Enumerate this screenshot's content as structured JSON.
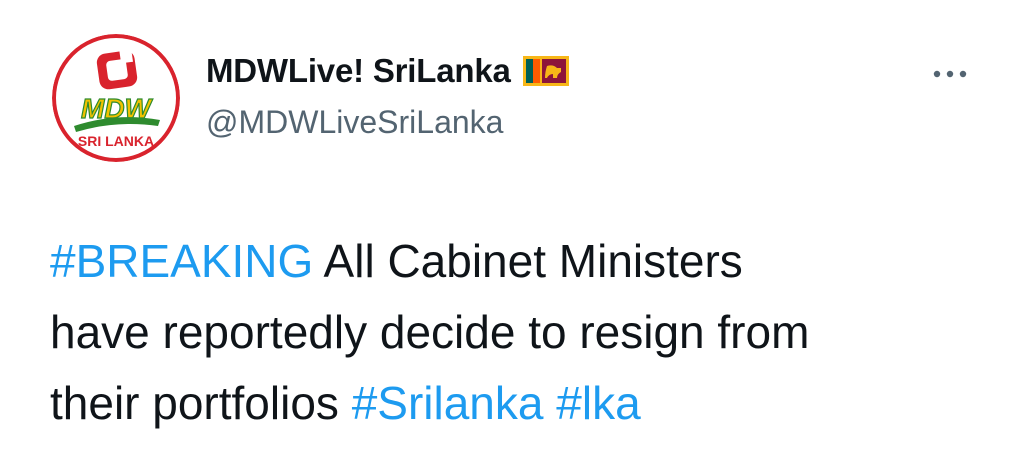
{
  "user": {
    "display_name": "MDWLive! SriLanka",
    "handle": "@MDWLiveSriLanka",
    "flag_icon": "sri-lanka-flag-icon",
    "avatar_logo_text": "SRI LANKA",
    "avatar_logo_brand": "MDW"
  },
  "menu": {
    "icon": "more-horizontal-icon"
  },
  "tweet": {
    "hashtag_breaking": "#BREAKING",
    "line1_rest": " All Cabinet Ministers",
    "line2": "have reportedly decide to resign from",
    "line3_start": "their portfolios ",
    "hashtag_srilanka": "#Srilanka",
    "line3_space": " ",
    "hashtag_lka": "#lka"
  },
  "colors": {
    "text": "#0f1419",
    "secondary": "#536471",
    "link": "#1d9bf0",
    "avatar_ring": "#d9232d",
    "logo_green": "#2e8b2e",
    "logo_yellow": "#f2c200"
  }
}
